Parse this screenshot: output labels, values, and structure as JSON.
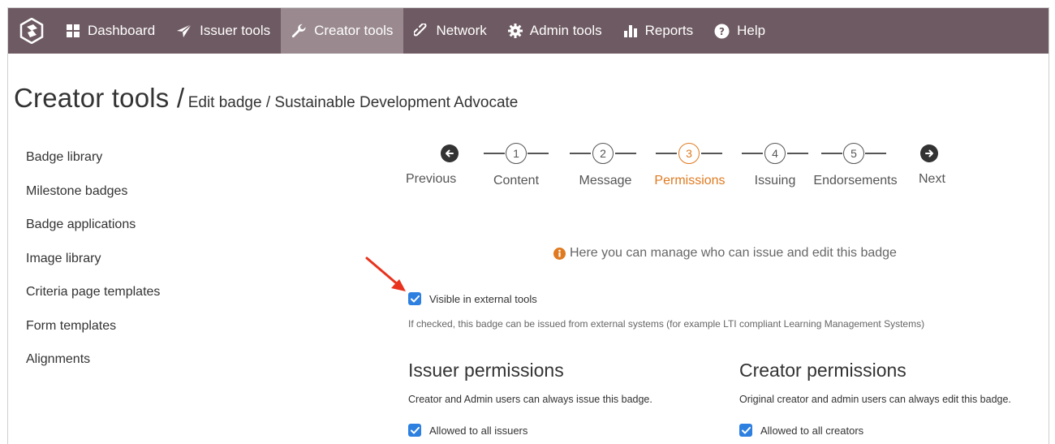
{
  "nav": {
    "items": [
      {
        "label": "Dashboard",
        "icon": "grid-icon"
      },
      {
        "label": "Issuer tools",
        "icon": "paper-plane-icon"
      },
      {
        "label": "Creator tools",
        "icon": "wrench-icon",
        "active": true
      },
      {
        "label": "Network",
        "icon": "link-icon"
      },
      {
        "label": "Admin tools",
        "icon": "gear-icon"
      },
      {
        "label": "Reports",
        "icon": "bar-chart-icon"
      },
      {
        "label": "Help",
        "icon": "question-circle-icon"
      }
    ]
  },
  "title": {
    "main": "Creator tools /",
    "sub": "Edit badge / Sustainable Development Advocate"
  },
  "sidebar": {
    "items": [
      {
        "label": "Badge library"
      },
      {
        "label": "Milestone badges"
      },
      {
        "label": "Badge applications"
      },
      {
        "label": "Image library"
      },
      {
        "label": "Criteria page templates"
      },
      {
        "label": "Form templates"
      },
      {
        "label": "Alignments"
      }
    ]
  },
  "stepper": {
    "previous": "Previous",
    "next": "Next",
    "steps": [
      {
        "number": "1",
        "label": "Content"
      },
      {
        "number": "2",
        "label": "Message"
      },
      {
        "number": "3",
        "label": "Permissions",
        "current": true
      },
      {
        "number": "4",
        "label": "Issuing"
      },
      {
        "number": "5",
        "label": "Endorsements"
      }
    ]
  },
  "info": {
    "text": "Here you can manage who can issue and edit this badge"
  },
  "visible_external": {
    "label": "Visible in external tools",
    "checked": true,
    "help": "If checked, this badge can be issued from external systems (for example LTI compliant Learning Management Systems)"
  },
  "issuer_permissions": {
    "heading": "Issuer permissions",
    "desc": "Creator and Admin users can always issue this badge.",
    "checkbox_label": "Allowed to all issuers",
    "checked": true
  },
  "creator_permissions": {
    "heading": "Creator permissions",
    "desc": "Original creator and admin users can always edit this badge.",
    "checkbox_label": "Allowed to all creators",
    "checked": true
  },
  "colors": {
    "nav_bg": "#6e5a62",
    "nav_active": "#9a8a90",
    "accent": "#e07a20",
    "checkbox": "#2d7fe0",
    "annotation": "#e8321e"
  }
}
